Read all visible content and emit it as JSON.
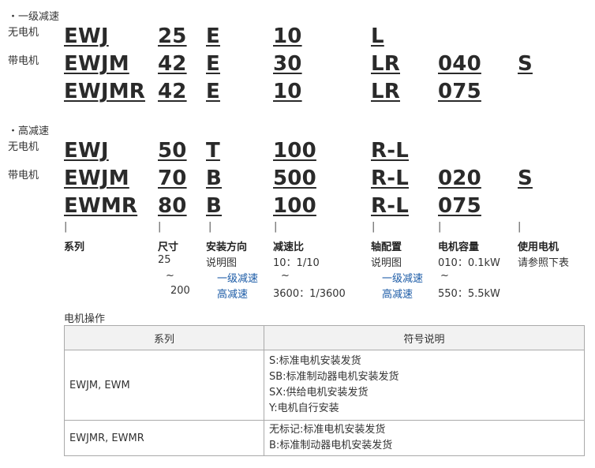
{
  "section1": {
    "title": "・一级减速",
    "label_no_motor": "无电机",
    "label_with_motor": "带电机",
    "rows": [
      [
        "EWJ",
        "25",
        "E",
        "10",
        "L",
        "",
        ""
      ],
      [
        "EWJM",
        "42",
        "E",
        "30",
        "LR",
        "040",
        "S"
      ],
      [
        "EWJMR",
        "42",
        "E",
        "10",
        "LR",
        "075",
        ""
      ]
    ]
  },
  "section2": {
    "title": "・高减速",
    "label_no_motor": "无电机",
    "label_with_motor": "带电机",
    "rows": [
      [
        "EWJ",
        "50",
        "T",
        "100",
        "R-L",
        "",
        ""
      ],
      [
        "EWJM",
        "70",
        "B",
        "500",
        "R-L",
        "020",
        "S"
      ],
      [
        "EWMR",
        "80",
        "B",
        "100",
        "R-L",
        "075",
        ""
      ]
    ]
  },
  "legend": {
    "pipe": "|",
    "series": "系列",
    "size": "尺寸",
    "size_min": "25",
    "size_tilde": "~",
    "size_max": "200",
    "mount": "安装方向",
    "mount_desc": "说明图",
    "mount_link1": "一级减速",
    "mount_link2": "高减速",
    "ratio": "减速比",
    "ratio_line1": "10：1/10",
    "ratio_tilde": "~",
    "ratio_line2": "3600：1/3600",
    "shaft": "轴配置",
    "shaft_desc": "说明图",
    "shaft_link1": "一级减速",
    "shaft_link2": "高减速",
    "motor_cap": "电机容量",
    "motor_line1": "010：0.1kW",
    "motor_tilde": "~",
    "motor_line2": "550：5.5kW",
    "use_motor": "使用电机",
    "use_desc": "请参照下表"
  },
  "motor_ops": {
    "title": "电机操作",
    "headers": [
      "系列",
      "符号说明"
    ],
    "rows": [
      {
        "series": "EWJM, EWM",
        "symbols": [
          "S:标准电机安装发货",
          "SB:标准制动器电机安装发货",
          "SX:供给电机安装发货",
          "Y:电机自行安装"
        ]
      },
      {
        "series": "EWJMR, EWMR",
        "symbols": [
          "无标记:标准电机安装发货",
          "B:标准制动器电机安装发货"
        ]
      }
    ]
  }
}
